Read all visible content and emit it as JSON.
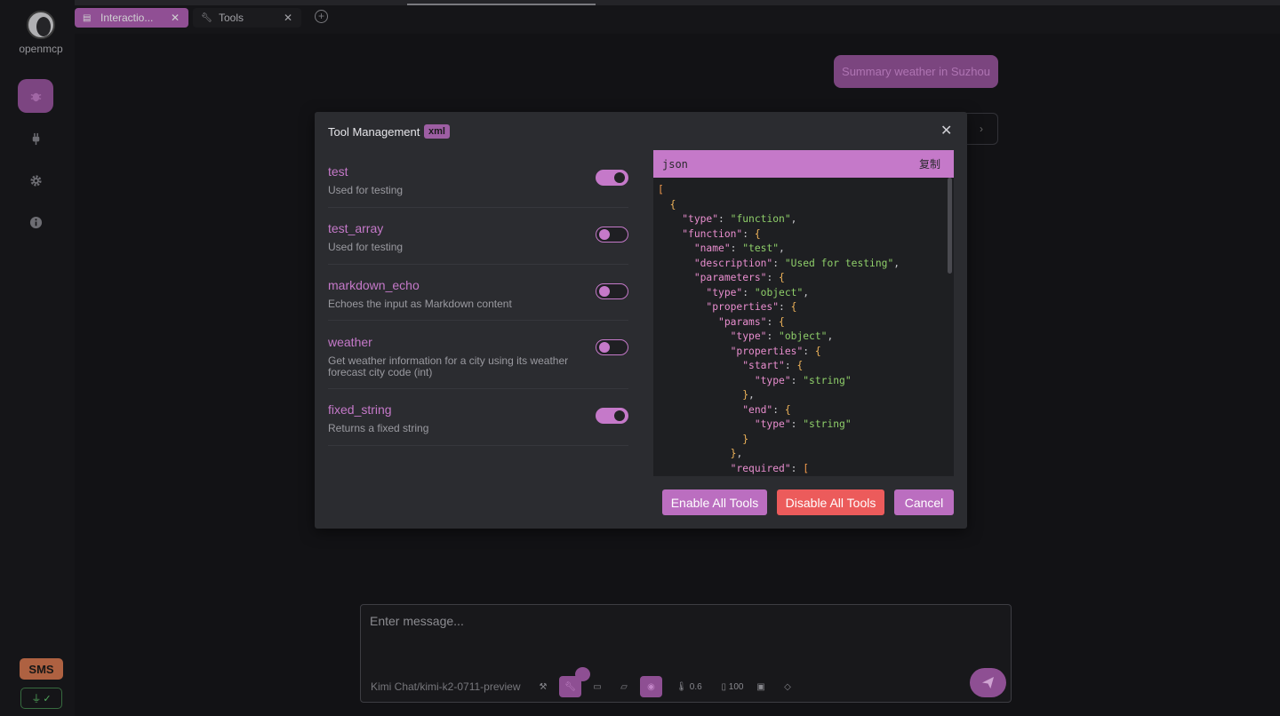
{
  "app": {
    "name": "openmcp"
  },
  "tabs": [
    {
      "label": "Interactio...",
      "active": true
    },
    {
      "label": "Tools",
      "active": false
    }
  ],
  "sidebar": {
    "items": [
      {
        "icon": "bug-icon",
        "active": true
      },
      {
        "icon": "plug-icon",
        "active": false
      },
      {
        "icon": "gear-icon",
        "active": false
      },
      {
        "icon": "info-icon",
        "active": false
      }
    ],
    "sms_label": "SMS",
    "status_icon": "check-circle-icon"
  },
  "chat": {
    "user_message": "Summary weather in Suzhou"
  },
  "modal": {
    "title": "Tool Management",
    "badge": "xml",
    "tools": [
      {
        "name": "test",
        "description": "Used for testing",
        "enabled": true
      },
      {
        "name": "test_array",
        "description": "Used for testing",
        "enabled": false
      },
      {
        "name": "markdown_echo",
        "description": "Echoes the input as Markdown content",
        "enabled": false
      },
      {
        "name": "weather",
        "description": "Get weather information for a city using its weather forecast city code (int)",
        "enabled": false
      },
      {
        "name": "fixed_string",
        "description": "Returns a fixed string",
        "enabled": true
      }
    ],
    "code": {
      "language": "json",
      "copy_label": "复制"
    },
    "buttons": {
      "enable_all": "Enable All Tools",
      "disable_all": "Disable All Tools",
      "cancel": "Cancel"
    }
  },
  "composer": {
    "placeholder": "Enter message...",
    "model": "Kimi Chat/kimi-k2-0711-preview",
    "temperature": "0.6",
    "context_length": "100"
  },
  "colors": {
    "accent": "#c579c9",
    "accent_dark": "#8e4f93",
    "danger": "#ec5b5b",
    "sms": "#c66f4a",
    "status_ok": "#5ec26a"
  }
}
